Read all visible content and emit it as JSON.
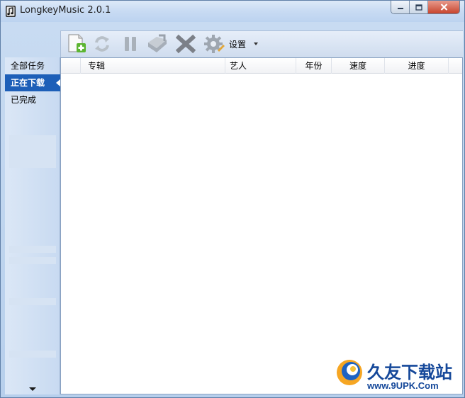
{
  "window": {
    "title": "LongkeyMusic 2.0.1",
    "accent_color": "#1d5fb8"
  },
  "title_bar_buttons": [
    {
      "name": "minimize",
      "icon": "minimize-icon"
    },
    {
      "name": "maximize",
      "icon": "maximize-icon"
    },
    {
      "name": "close",
      "icon": "close-icon"
    }
  ],
  "toolbar": {
    "buttons": [
      {
        "name": "add",
        "icon": "add-icon"
      },
      {
        "name": "refresh",
        "icon": "refresh-icon"
      },
      {
        "name": "pause",
        "icon": "pause-icon"
      },
      {
        "name": "open",
        "icon": "open-icon"
      },
      {
        "name": "delete",
        "icon": "delete-icon"
      },
      {
        "name": "settings",
        "icon": "gear-icon"
      }
    ],
    "settings_label": "设置"
  },
  "sidebar": {
    "items": [
      {
        "label": "全部任务",
        "active": false
      },
      {
        "label": "正在下载",
        "active": true
      },
      {
        "label": "已完成",
        "active": false
      }
    ]
  },
  "list": {
    "columns": [
      "专辑",
      "艺人",
      "年份",
      "速度",
      "进度"
    ],
    "rows": []
  },
  "watermark": {
    "name": "久友下载站",
    "url": "www.9UPK.Com"
  }
}
